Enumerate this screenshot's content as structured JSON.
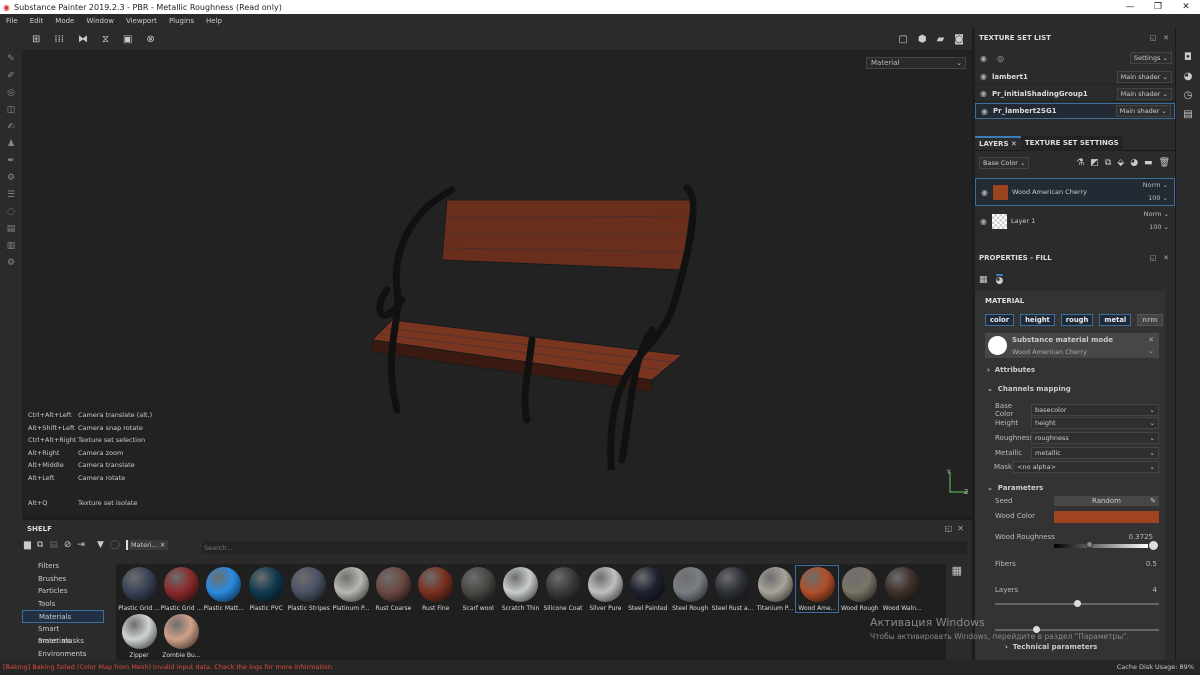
{
  "window": {
    "title": "Substance Painter 2019.2.3 - PBR - Metallic Roughness (Read only)",
    "controls": [
      "—",
      "❐",
      "✕"
    ]
  },
  "menu": [
    "File",
    "Edit",
    "Mode",
    "Window",
    "Viewport",
    "Plugins",
    "Help"
  ],
  "viewport": {
    "mode_select": "Material",
    "hints": [
      [
        "Ctrl+Alt+Left",
        "Camera translate (alt.)"
      ],
      [
        "Alt+Shift+Left",
        "Camera snap rotate"
      ],
      [
        "Ctrl+Alt+Right",
        "Texture set selection"
      ],
      [
        "Alt+Right",
        "Camera zoom"
      ],
      [
        "Alt+Middle",
        "Camera translate"
      ],
      [
        "Alt+Left",
        "Camera rotate"
      ],
      [
        "Alt+Q",
        "Texture set isolate"
      ]
    ]
  },
  "texture_set_list": {
    "title": "TEXTURE SET LIST",
    "settings": "Settings",
    "items": [
      {
        "name": "lambert1",
        "shader": "Main shader"
      },
      {
        "name": "Pr_initialShadingGroup1",
        "shader": "Main shader"
      },
      {
        "name": "Pr_lambert2SG1",
        "shader": "Main shader"
      }
    ]
  },
  "layers": {
    "tab": "LAYERS",
    "tab2": "TEXTURE SET SETTINGS",
    "channel": "Base Color",
    "items": [
      {
        "name": "Wood American Cherry",
        "blend": "Norm",
        "opacity": "100"
      },
      {
        "name": "Layer 1",
        "blend": "Norm",
        "opacity": "100"
      }
    ]
  },
  "properties": {
    "title": "PROPERTIES - FILL",
    "material_label": "MATERIAL",
    "chips": [
      "color",
      "height",
      "rough",
      "metal",
      "nrm"
    ],
    "mode_title": "Substance material mode",
    "mode_value": "Wood American Cherry",
    "attributes": "Attributes",
    "channels_mapping": "Channels mapping",
    "mapping": [
      [
        "Base Color",
        "basecolor"
      ],
      [
        "Height",
        "height"
      ],
      [
        "Roughness",
        "roughness"
      ],
      [
        "Metallic",
        "metallic"
      ]
    ],
    "mask_label": "Mask",
    "mask_value": "<no alpha>",
    "parameters": "Parameters",
    "seed_label": "Seed",
    "seed_value": "Random",
    "wood_color_label": "Wood Color",
    "wood_color": "#a2431f",
    "wood_roughness_label": "Wood Roughness",
    "wood_roughness": "0.3725",
    "fibers_label": "Fibers",
    "fibers": "0.5",
    "layers_label": "Layers",
    "layers_value": "4",
    "technical": "Technical parameters"
  },
  "shelf": {
    "title": "SHELF",
    "filter_tag": "Materi...",
    "search_placeholder": "Search...",
    "categories": [
      "Filters",
      "Brushes",
      "Particles",
      "Tools",
      "Materials",
      "Smart materials",
      "Smart masks",
      "Environments"
    ],
    "selected_category": "Materials",
    "materials": [
      {
        "n": "Plastic Grid ...",
        "c": "#3a4256"
      },
      {
        "n": "Plastic Grid ...",
        "c": "#8a2a2c"
      },
      {
        "n": "Plastic Matt...",
        "c": "#2a8ae0"
      },
      {
        "n": "Plastic PVC",
        "c": "#103a50"
      },
      {
        "n": "Plastic Stripes",
        "c": "#4a5264"
      },
      {
        "n": "Platinum P...",
        "c": "#b8b8b0"
      },
      {
        "n": "Rust Coarse",
        "c": "#6a4a40"
      },
      {
        "n": "Rust Fine",
        "c": "#7a3020"
      },
      {
        "n": "Scarf wool",
        "c": "#4a4844"
      },
      {
        "n": "Scratch Thin",
        "c": "#c8cccc"
      },
      {
        "n": "Silicone Coat",
        "c": "#3a3a3a"
      },
      {
        "n": "Silver Pure",
        "c": "#c0c0c0"
      },
      {
        "n": "Steel Painted",
        "c": "#1e2230"
      },
      {
        "n": "Steel Rough",
        "c": "#7a7e84"
      },
      {
        "n": "Steel Rust a...",
        "c": "#2e3038"
      },
      {
        "n": "Titanium P...",
        "c": "#a8a49a"
      },
      {
        "n": "Wood Ame...",
        "c": "#b0502a"
      },
      {
        "n": "Wood Rough",
        "c": "#7a7466"
      },
      {
        "n": "Wood Waln...",
        "c": "#3e302a"
      },
      {
        "n": "Zipper",
        "c": "#d0d4d4"
      },
      {
        "n": "Zombie Bu...",
        "c": "#d0a08a"
      }
    ],
    "selected_material": "Wood Ame..."
  },
  "status": {
    "message": "[Baking] Baking failed (Color Map from Mesh) Invalid input data. Check the logs for more information.",
    "cache": "Cache Disk Usage:   89%"
  },
  "watermark": {
    "line1": "Активация Windows",
    "line2": "Чтобы активировать Windows, перейдите в раздел \"Параметры\"."
  }
}
